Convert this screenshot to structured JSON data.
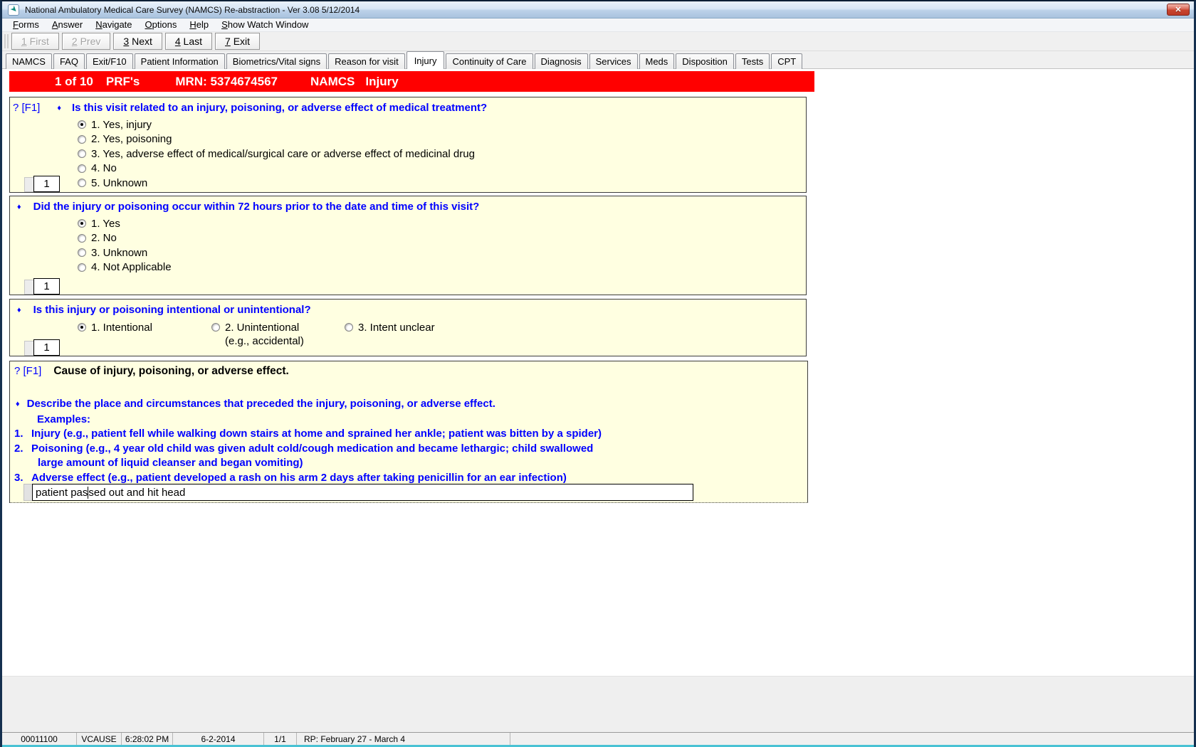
{
  "window": {
    "title": "National Ambulatory Medical Care Survey (NAMCS) Re-abstraction  - Ver 3.08 5/12/2014",
    "close_glyph": "✕"
  },
  "menu_bar": {
    "items": [
      "Forms",
      "Answer",
      "Navigate",
      "Options",
      "Help",
      "Show Watch Window"
    ]
  },
  "toolbar": {
    "buttons": [
      {
        "label": "1 First",
        "enabled": false
      },
      {
        "label": "2 Prev",
        "enabled": false
      },
      {
        "label": "3 Next",
        "enabled": true
      },
      {
        "label": "4 Last",
        "enabled": true
      },
      {
        "label": "7 Exit",
        "enabled": true
      }
    ]
  },
  "tab_bar": {
    "tabs": [
      {
        "label": "NAMCS",
        "active": false
      },
      {
        "label": "FAQ",
        "active": false
      },
      {
        "label": "Exit/F10",
        "active": false
      },
      {
        "label": "Patient Information",
        "active": false
      },
      {
        "label": "Biometrics/Vital signs",
        "active": false
      },
      {
        "label": "Reason for visit",
        "active": false
      },
      {
        "label": "Injury",
        "active": true
      },
      {
        "label": "Continuity of Care",
        "active": false
      },
      {
        "label": "Diagnosis",
        "active": false
      },
      {
        "label": "Services",
        "active": false
      },
      {
        "label": "Meds",
        "active": false
      },
      {
        "label": "Disposition",
        "active": false
      },
      {
        "label": "Tests",
        "active": false
      },
      {
        "label": "CPT",
        "active": false
      }
    ]
  },
  "banner": {
    "progress": "1 of 10",
    "unit": "PRF's",
    "mrn": "MRN: 5374674567",
    "survey": "NAMCS",
    "section": "Injury",
    "background": "#ff0000"
  },
  "questions": [
    {
      "help": "? [F1]",
      "bullet": "♦",
      "text": "Is this visit related to an injury, poisoning, or adverse effect of medical treatment?",
      "options": [
        {
          "label": "1. Yes, injury",
          "selected": true
        },
        {
          "label": "2. Yes, poisoning",
          "selected": false
        },
        {
          "label": "3. Yes, adverse effect of medical/surgical care or adverse effect of medicinal drug",
          "selected": false
        },
        {
          "label": "4. No",
          "selected": false
        },
        {
          "label": "5. Unknown",
          "selected": false
        }
      ],
      "answer": "1"
    },
    {
      "bullet": "♦",
      "text": "Did the injury or poisoning occur within 72 hours prior to the date and time of this visit?",
      "options": [
        {
          "label": "1. Yes",
          "selected": true
        },
        {
          "label": "2. No",
          "selected": false
        },
        {
          "label": "3. Unknown",
          "selected": false
        },
        {
          "label": "4. Not Applicable",
          "selected": false
        }
      ],
      "answer": "1"
    },
    {
      "bullet": "♦",
      "text": "Is this injury or poisoning intentional or unintentional?",
      "options": [
        {
          "label": "1. Intentional",
          "selected": true
        },
        {
          "label": "2. Unintentional",
          "sub": "(e.g., accidental)",
          "selected": false
        },
        {
          "label": "3. Intent unclear",
          "selected": false
        }
      ],
      "answer": "1"
    },
    {
      "help": "? [F1]",
      "title": "Cause of injury, poisoning, or adverse effect.",
      "bullet": "♦",
      "text": "Describe the place and circumstances that preceded the injury, poisoning, or adverse effect.",
      "examples_label": "Examples:",
      "examples": [
        {
          "num": "1.",
          "lines": [
            "Injury (e.g., patient fell while walking down stairs at home and sprained her ankle; patient was bitten by a spider)"
          ]
        },
        {
          "num": "2.",
          "lines": [
            "Poisoning (e.g., 4 year old child was given adult cold/cough medication and became lethargic; child swallowed",
            "large amount of liquid cleanser and began vomiting)"
          ]
        },
        {
          "num": "3.",
          "lines": [
            "Adverse effect (e.g., patient developed a rash on his arm 2 days after taking penicillin for an ear infection)"
          ]
        }
      ],
      "input": {
        "before_caret": "patient pas",
        "after_caret": "sed out and hit head"
      }
    }
  ],
  "status_bar": {
    "cells": [
      "00011100",
      "VCAUSE",
      "6:28:02 PM",
      "6-2-2014",
      "1/1",
      "RP: February 27 - March 4"
    ]
  },
  "colors": {
    "question_blue": "#0000ff",
    "panel_background": "#ffffe1",
    "banner_red": "#ff0000"
  }
}
